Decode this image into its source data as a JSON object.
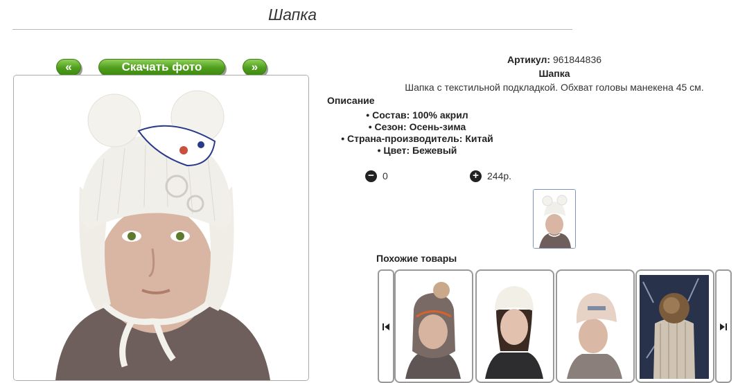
{
  "page": {
    "title": "Шапка"
  },
  "gallery": {
    "prev_label": "«",
    "download_label": "Скачать фото",
    "next_label": "»"
  },
  "product": {
    "article_label": "Артикул:",
    "article_value": "961844836",
    "name": "Шапка",
    "description": "Шапка с текстильной подкладкой. Обхват головы манекена 45 см.",
    "description_heading": "Описание",
    "specs": [
      "Состав: 100% акрил",
      "Сезон: Осень-зима",
      "Страна-производитель: Китай",
      "Цвет: Бежевый"
    ]
  },
  "cart": {
    "minus_icon": "minus-circle-icon",
    "quantity": "0",
    "plus_icon": "plus-circle-icon",
    "price": "244р."
  },
  "similar": {
    "heading": "Похожие товары",
    "prev_icon": "skip-previous-icon",
    "next_icon": "skip-next-icon",
    "items": [
      {
        "image": "brown-helmet-hat-photo"
      },
      {
        "image": "white-hat-girl-photo"
      },
      {
        "image": "beige-venichy-hat-photo"
      },
      {
        "image": "knit-fur-pompom-hat-photo"
      }
    ]
  },
  "colors": {
    "button_green": "#4f9e1c",
    "hat_white": "#f1efe9",
    "sweater_brown": "#6e5f5c"
  }
}
